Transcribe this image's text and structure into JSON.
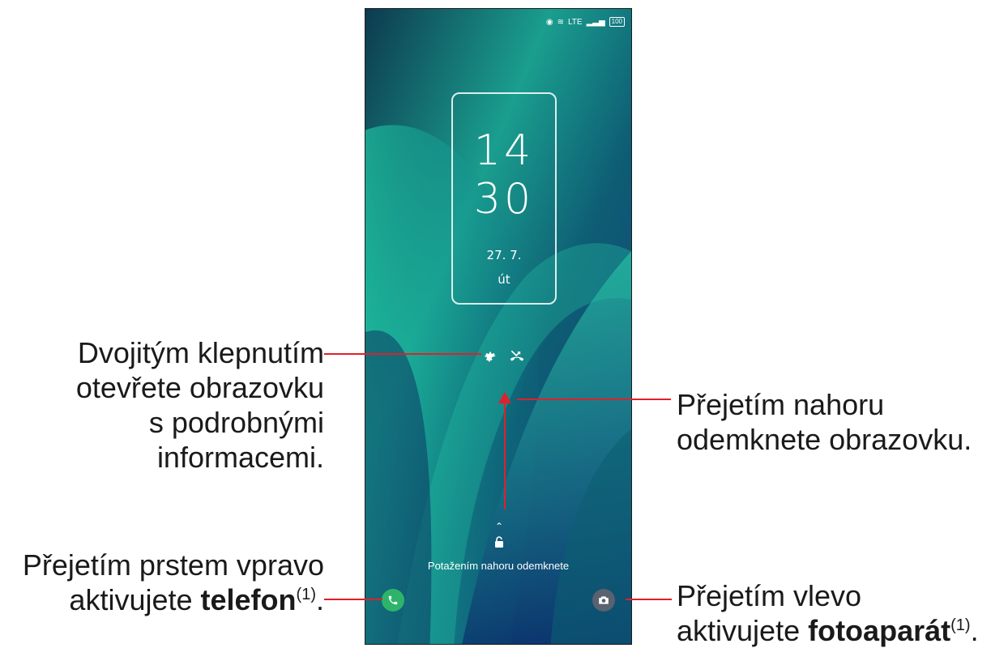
{
  "status_bar": {
    "network": "LTE",
    "battery": "100"
  },
  "lockscreen": {
    "clock_hours": "14",
    "clock_minutes": "30",
    "date": "27. 7.",
    "day": "út",
    "unlock_hint": "Potažením nahoru odemknete"
  },
  "annotations": {
    "double_tap": [
      "Dvojitým klepnutím",
      "otevřete obrazovku",
      "s podrobnými",
      "informacemi."
    ],
    "swipe_up": [
      "Přejetím nahoru",
      "odemknete obrazovku."
    ],
    "swipe_right": {
      "line1": "Přejetím prstem vpravo",
      "line2_pre": "aktivujete ",
      "line2_bold": "telefon",
      "sup": "(1)",
      "end": "."
    },
    "swipe_left": {
      "line1": "Přejetím vlevo",
      "line2_pre": "aktivujete ",
      "line2_bold": "fotoaparát",
      "sup": "(1)",
      "end": "."
    }
  },
  "colors": {
    "accent_line": "#e0202a",
    "phone_button": "#2db46a",
    "camera_button": "#5a6270"
  }
}
